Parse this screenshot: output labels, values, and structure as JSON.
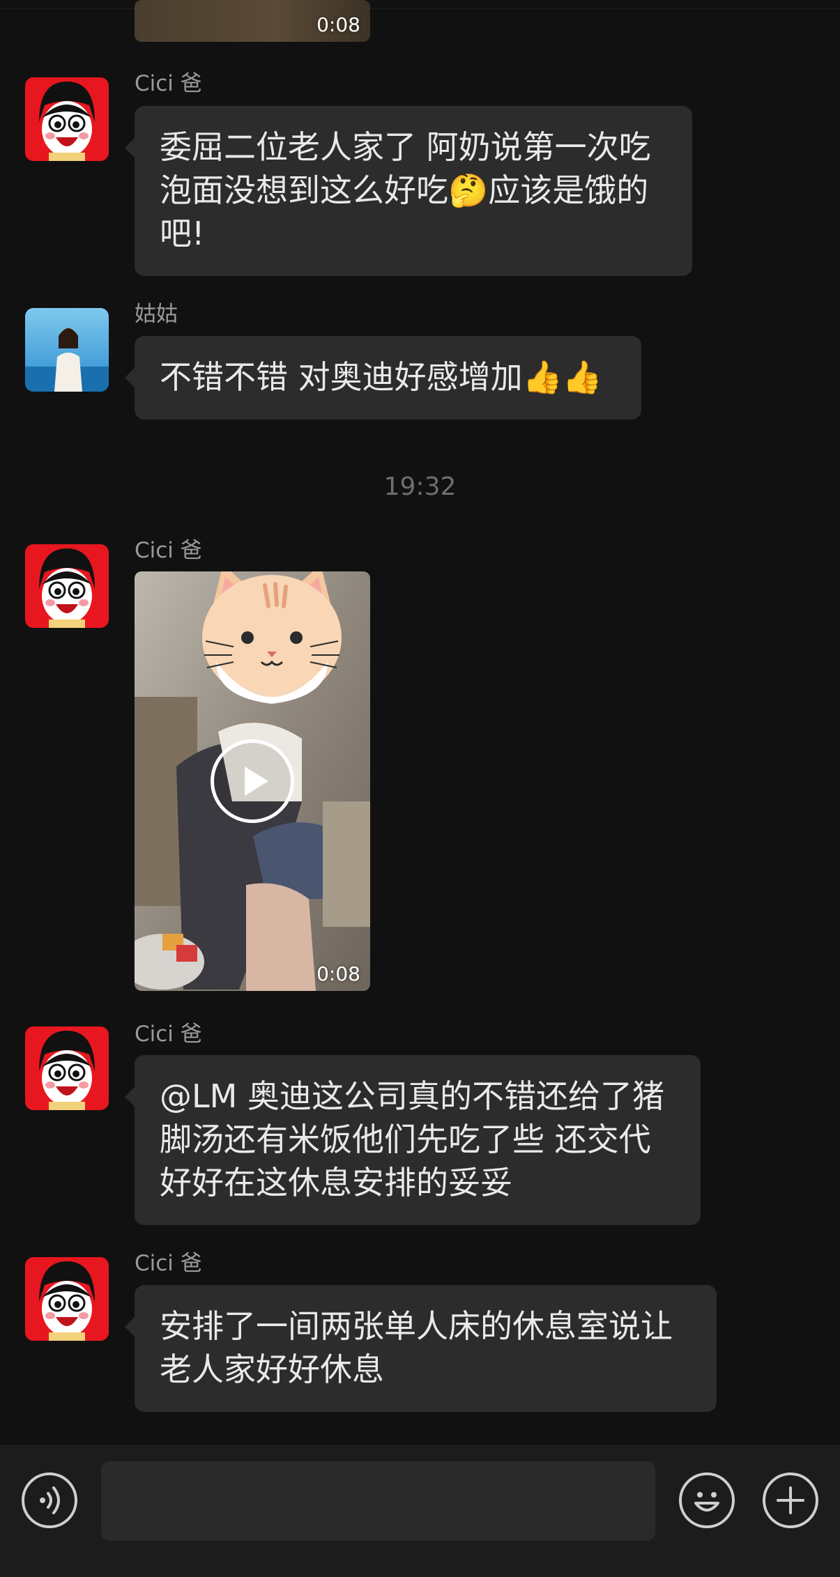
{
  "messages": [
    {
      "sender": "Cici 爸",
      "lines": [
        "委屈二位老人家了 阿奶说第一次吃",
        "泡面没想到这么好吃🤔应该是饿的",
        "吧!"
      ]
    },
    {
      "sender": "姑姑",
      "lines": [
        "不错不错 对奥迪好感增加👍👍"
      ]
    },
    {
      "sender": "Cici 爸",
      "video_duration": "0:08"
    },
    {
      "sender": "Cici 爸",
      "lines": [
        "@LM 奥迪这公司真的不错还给了猪",
        "脚汤还有米饭他们先吃了些 还交代",
        "好好在这休息安排的妥妥"
      ]
    },
    {
      "sender": "Cici 爸",
      "lines": [
        "安排了一间两张单人床的休息室说让",
        "老人家好好休息"
      ]
    }
  ],
  "top_video_duration": "0:08",
  "timestamp": "19:32",
  "icons": {
    "voice": "voice-icon",
    "emoji": "emoji-icon",
    "add": "plus-icon",
    "play": "play-icon"
  },
  "colors": {
    "background": "#111111",
    "bubble": "#2c2c2c",
    "avatar_red": "#e8171f",
    "input_bar": "#1c1c1c"
  }
}
